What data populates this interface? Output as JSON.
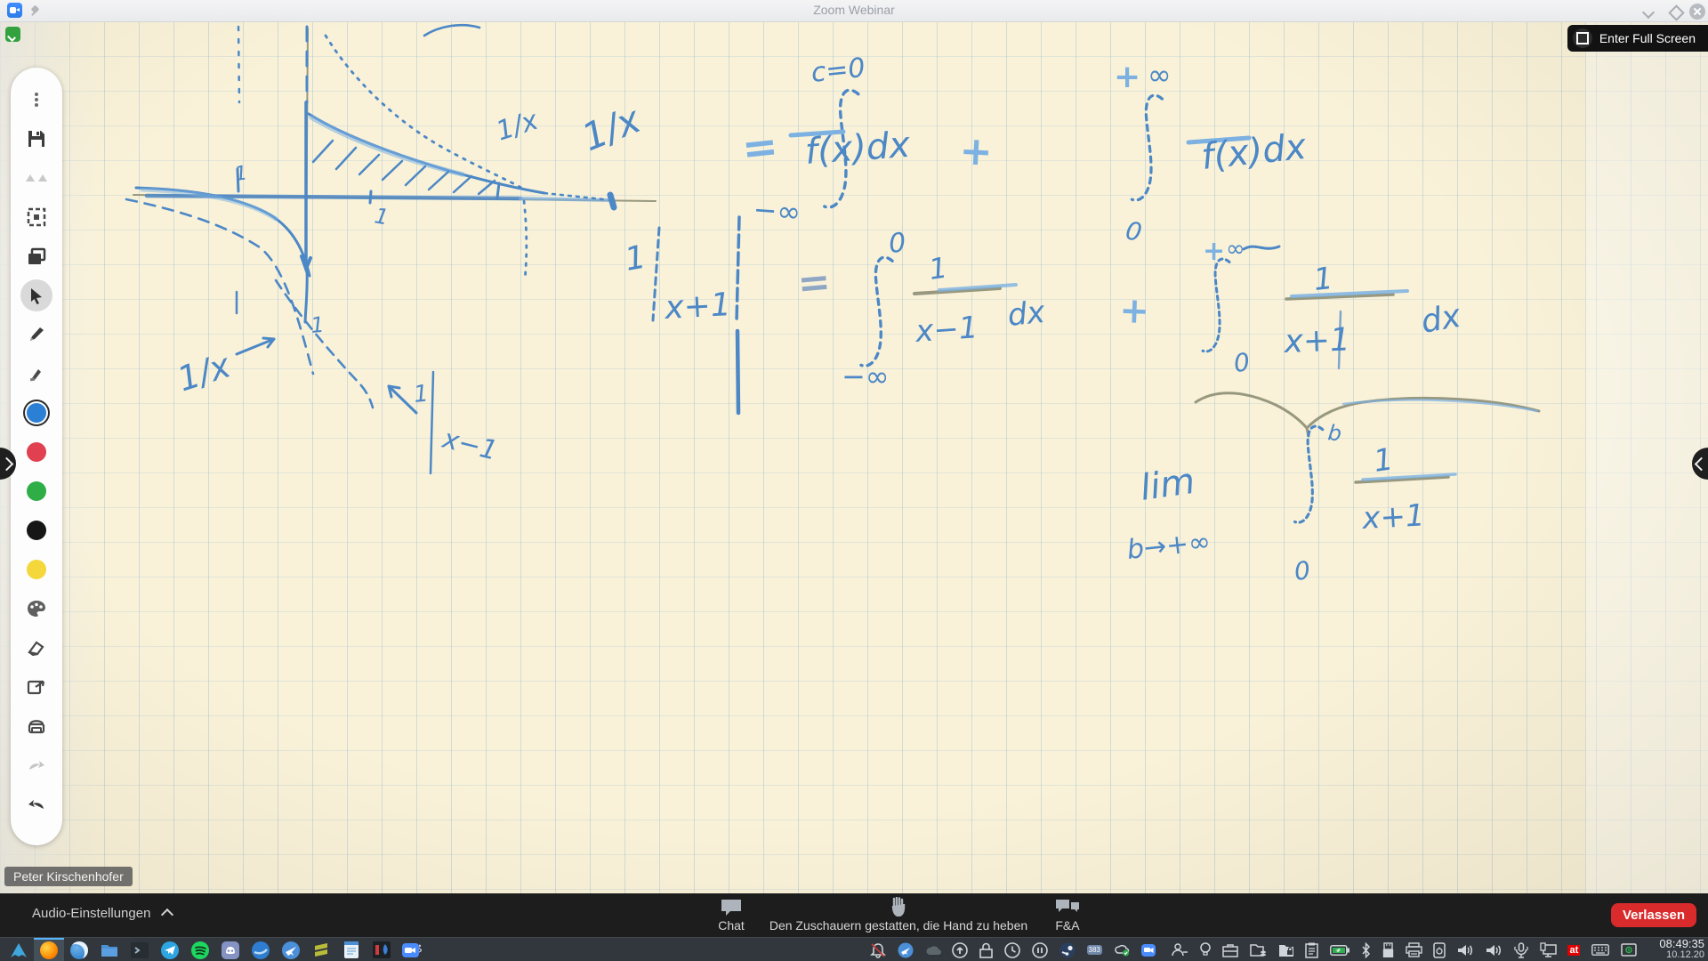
{
  "titlebar": {
    "title": "Zoom Webinar"
  },
  "fullscreen_button": {
    "label": "Enter Full Screen"
  },
  "toolbar": {
    "swatches": {
      "blue": "#2b7fd4",
      "red": "#e04050",
      "green": "#2fae47",
      "black": "#161616",
      "yellow": "#f3d73b"
    }
  },
  "nameplate": {
    "name": "Peter Kirschenhofer"
  },
  "controlbar": {
    "audio_label": "Audio-Einstellungen",
    "chat_label": "Chat",
    "hand_label": "Den Zuschauern gestatten, die Hand zu heben",
    "qa_label": "F&A",
    "leave_label": "Verlassen"
  },
  "taskbar": {
    "badge_383": "383",
    "keyboard_layout": "at",
    "time": "08:49:35",
    "date": "10.12.20"
  },
  "whiteboard": {
    "l1": {
      "eq": "=",
      "c0": "c=0",
      "lo1": "−∞",
      "fx1": "f(x)dx",
      "plus": "+",
      "hi2_plus": "+",
      "hi2_inf": "∞",
      "fx2": "f(x)dx",
      "lo2": "0"
    },
    "l2": {
      "num0": "1",
      "abs_body": "x+1",
      "eq": "=",
      "hi1": "0",
      "lo1": "−∞",
      "num1": "1",
      "den1": "x−1",
      "dx1": "dx",
      "plus": "+",
      "hi2_plus": "+",
      "hi2_inf": "∞",
      "num2": "1",
      "den2": "x+1",
      "dx2": "dx",
      "lo2": "0"
    },
    "lim": {
      "word": "lim",
      "sub": "b→+∞",
      "hi": "b",
      "lo": "0",
      "num": "1",
      "den": "x+1"
    },
    "sketch": {
      "label_1x_formula": "1/x",
      "label_1x_right": "1/x",
      "label_1x_bottom": "1/x",
      "tick_1_axis": "1",
      "tick_1_left": "1",
      "tick_1_inner": "1",
      "tick_1_br": "1",
      "label_abs_br": "x−1"
    }
  }
}
